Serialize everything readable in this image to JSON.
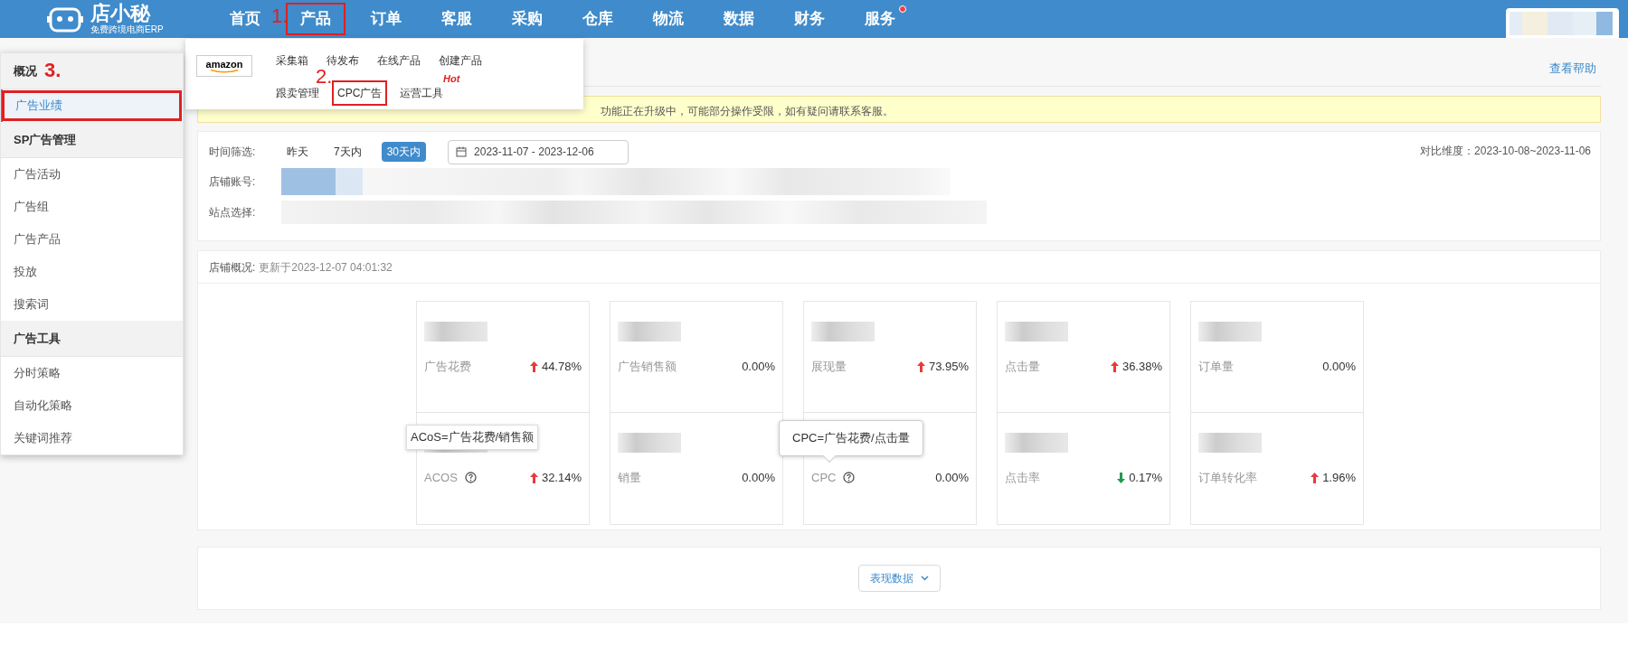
{
  "logo": {
    "name": "店小秘",
    "tagline": "免费跨境电商ERP"
  },
  "nav": [
    {
      "label": "首页",
      "marked": false,
      "dot": false
    },
    {
      "label": "产品",
      "marked": true,
      "callout": "1.",
      "dot": false
    },
    {
      "label": "订单",
      "marked": false,
      "dot": false
    },
    {
      "label": "客服",
      "marked": false,
      "dot": false
    },
    {
      "label": "采购",
      "marked": false,
      "dot": false
    },
    {
      "label": "仓库",
      "marked": false,
      "dot": false
    },
    {
      "label": "物流",
      "marked": false,
      "dot": false
    },
    {
      "label": "数据",
      "marked": false,
      "dot": false
    },
    {
      "label": "财务",
      "marked": false,
      "dot": false
    },
    {
      "label": "服务",
      "marked": false,
      "dot": true
    }
  ],
  "dropdown": {
    "brand": "amazon",
    "rows": [
      {
        "items": [
          {
            "label": "采集箱",
            "marked": false
          },
          {
            "label": "待发布",
            "marked": false
          },
          {
            "label": "在线产品",
            "marked": false
          },
          {
            "label": "创建产品",
            "marked": false
          }
        ]
      },
      {
        "items": [
          {
            "label": "跟卖管理",
            "marked": false
          },
          {
            "label": "CPC广告",
            "marked": true,
            "callout": "2."
          },
          {
            "label": "运营工具",
            "marked": false,
            "tag": "Hot"
          }
        ]
      }
    ]
  },
  "sidebar": [
    {
      "title": "概况",
      "callout": "3.",
      "items": [
        {
          "label": "广告业绩",
          "selected": true,
          "marked": true
        }
      ]
    },
    {
      "title": "SP广告管理",
      "items": [
        {
          "label": "广告活动",
          "selected": false,
          "marked": false
        },
        {
          "label": "广告组",
          "selected": false,
          "marked": false
        },
        {
          "label": "广告产品",
          "selected": false,
          "marked": false
        },
        {
          "label": "投放",
          "selected": false,
          "marked": false
        },
        {
          "label": "搜索词",
          "selected": false,
          "marked": false
        }
      ]
    },
    {
      "title": "广告工具",
      "items": [
        {
          "label": "分时策略",
          "selected": false,
          "marked": false
        },
        {
          "label": "自动化策略",
          "selected": false,
          "marked": false
        },
        {
          "label": "关键词推荐",
          "selected": false,
          "marked": false
        }
      ]
    }
  ],
  "help_link": "查看帮助",
  "notice": "功能正在升级中，可能部分操作受限，如有疑问请联系客服。",
  "filters": {
    "time_label": "时间筛选:",
    "time_options": [
      {
        "label": "昨天",
        "selected": false
      },
      {
        "label": "7天内",
        "selected": false
      },
      {
        "label": "30天内",
        "selected": true
      }
    ],
    "date_range": "2023-11-07 - 2023-12-06",
    "compare": "对比维度：2023-10-08~2023-11-06",
    "store_label": "店铺账号:",
    "site_label": "站点选择:"
  },
  "overview": {
    "label": "店铺概况:",
    "updated": "更新于2023-12-07 04:01:32"
  },
  "metric_rows": [
    {
      "metrics": [
        {
          "label": "广告花费",
          "change": "44.78%",
          "increase": true,
          "decrease": false,
          "help": false
        },
        {
          "label": "广告销售额",
          "change": "0.00%",
          "increase": false,
          "decrease": false,
          "help": false
        },
        {
          "label": "展现量",
          "change": "73.95%",
          "increase": true,
          "decrease": false,
          "help": false
        },
        {
          "label": "点击量",
          "change": "36.38%",
          "increase": true,
          "decrease": false,
          "help": false
        },
        {
          "label": "订单量",
          "change": "0.00%",
          "increase": false,
          "decrease": false,
          "help": false
        }
      ]
    },
    {
      "metrics": [
        {
          "label": "ACOS",
          "change": "32.14%",
          "increase": true,
          "decrease": false,
          "help": true,
          "tooltip": "ACoS=广告花费/销售额",
          "tooltip_pointer": false
        },
        {
          "label": "销量",
          "change": "0.00%",
          "increase": false,
          "decrease": false,
          "help": false
        },
        {
          "label": "CPC",
          "change": "0.00%",
          "increase": false,
          "decrease": false,
          "help": true,
          "tooltip": "CPC=广告花费/点击量",
          "tooltip_pointer": true
        },
        {
          "label": "点击率",
          "change": "0.17%",
          "increase": false,
          "decrease": true,
          "help": false
        },
        {
          "label": "订单转化率",
          "change": "1.96%",
          "increase": true,
          "decrease": false,
          "help": false
        }
      ]
    }
  ],
  "bottom_button": "表现数据"
}
